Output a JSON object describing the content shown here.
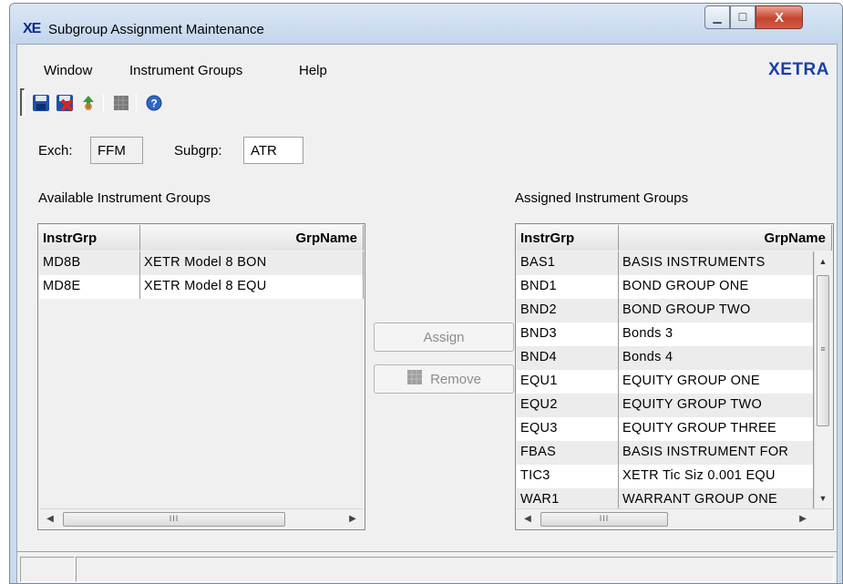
{
  "window": {
    "title": "Subgroup Assignment Maintenance",
    "app_icon_text": "XE",
    "minimize_glyph": "▁",
    "maximize_glyph": "☐",
    "close_glyph": "X"
  },
  "menu": {
    "items": [
      "Window",
      "Instrument Groups",
      "Help"
    ],
    "brand": "XETRA"
  },
  "toolbar": {
    "buttons": [
      "save-icon",
      "delete-icon",
      "recycle-icon",
      "grid-icon",
      "help-icon"
    ]
  },
  "form": {
    "exch_label": "Exch:",
    "exch_value": "FFM",
    "subgrp_label": "Subgrp:",
    "subgrp_value": "ATR"
  },
  "available": {
    "title": "Available Instrument Groups",
    "columns": [
      "InstrGrp",
      "GrpName"
    ],
    "rows": [
      [
        "MD8B",
        "XETR Model 8 BON"
      ],
      [
        "MD8E",
        "XETR Model 8 EQU"
      ]
    ]
  },
  "assigned": {
    "title": "Assigned Instrument Groups",
    "columns": [
      "InstrGrp",
      "GrpName"
    ],
    "rows": [
      [
        "BAS1",
        "BASIS INSTRUMENTS"
      ],
      [
        "BND1",
        "BOND GROUP ONE"
      ],
      [
        "BND2",
        "BOND GROUP TWO"
      ],
      [
        "BND3",
        "Bonds 3"
      ],
      [
        "BND4",
        "Bonds 4"
      ],
      [
        "EQU1",
        "EQUITY GROUP ONE"
      ],
      [
        "EQU2",
        "EQUITY GROUP TWO"
      ],
      [
        "EQU3",
        "EQUITY GROUP THREE"
      ],
      [
        "FBAS",
        "BASIS INSTRUMENT FOR"
      ],
      [
        "TIC3",
        "XETR Tic Siz 0.001 EQU"
      ],
      [
        "WAR1",
        "WARRANT GROUP ONE"
      ]
    ]
  },
  "actions": {
    "assign_label": "Assign",
    "remove_label": "Remove",
    "enabled": false
  },
  "colors": {
    "brand": "#1a3fa8",
    "title_bar": "#c9daee",
    "close_button": "#c5432e",
    "disabled_text": "#8c8c8c"
  }
}
